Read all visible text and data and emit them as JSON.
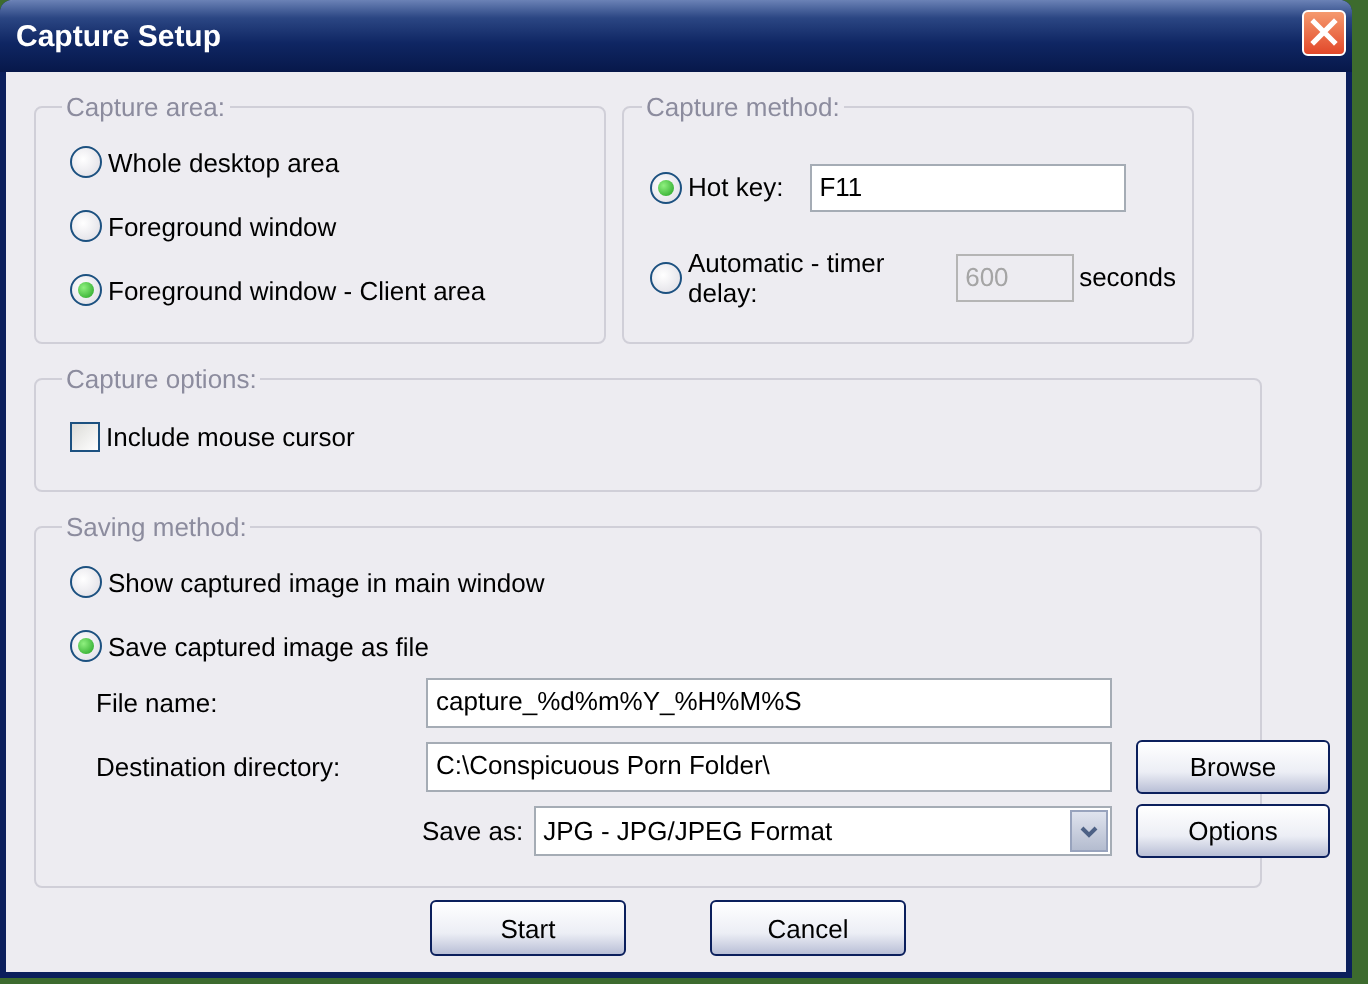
{
  "window": {
    "title": "Capture Setup"
  },
  "capture_area": {
    "legend": "Capture area:",
    "options": [
      {
        "label": "Whole desktop area",
        "selected": false
      },
      {
        "label": "Foreground window",
        "selected": false
      },
      {
        "label": "Foreground window - Client area",
        "selected": true
      }
    ]
  },
  "capture_method": {
    "legend": "Capture method:",
    "options": [
      {
        "label": "Hot key:",
        "selected": true,
        "field": {
          "value": "F11",
          "disabled": false
        }
      },
      {
        "label": "Automatic - timer delay:",
        "selected": false,
        "field": {
          "value": "600",
          "disabled": true
        },
        "unit": "seconds"
      }
    ]
  },
  "capture_options": {
    "legend": "Capture options:",
    "checkboxes": [
      {
        "label": "Include mouse cursor",
        "checked": false
      }
    ]
  },
  "saving_method": {
    "legend": "Saving method:",
    "options": [
      {
        "label": "Show captured image in main window",
        "selected": false
      },
      {
        "label": "Save captured image as file",
        "selected": true
      }
    ],
    "fields": [
      {
        "label": "File name:",
        "value": "capture_%d%m%Y_%H%M%S"
      },
      {
        "label": "Destination directory:",
        "value": "C:\\Conspicuous Porn Folder\\",
        "button": "Browse"
      }
    ],
    "save_as": {
      "label": "Save as:",
      "value": "JPG - JPG/JPEG Format",
      "button": "Options"
    }
  },
  "buttons": [
    "Start",
    "Cancel"
  ]
}
